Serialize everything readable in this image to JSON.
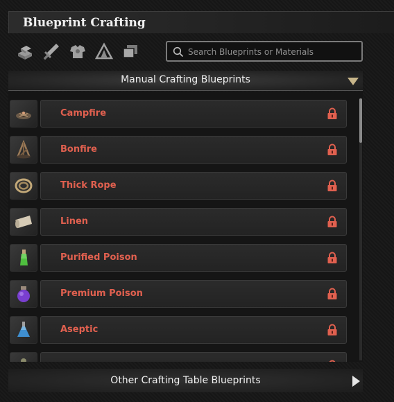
{
  "window": {
    "title": "Blueprint Crafting"
  },
  "categories": [
    {
      "icon": "materials-icon"
    },
    {
      "icon": "weapons-icon"
    },
    {
      "icon": "armor-icon"
    },
    {
      "icon": "tent-icon"
    },
    {
      "icon": "structures-icon"
    }
  ],
  "search": {
    "placeholder": "Search Blueprints or Materials",
    "value": ""
  },
  "manual_section": {
    "label": "Manual Crafting Blueprints"
  },
  "items": [
    {
      "name": "Campfire",
      "icon": "campfire-icon",
      "locked": true
    },
    {
      "name": "Bonfire",
      "icon": "bonfire-icon",
      "locked": true
    },
    {
      "name": "Thick Rope",
      "icon": "rope-icon",
      "locked": true
    },
    {
      "name": "Linen",
      "icon": "linen-icon",
      "locked": true
    },
    {
      "name": "Purified Poison",
      "icon": "purified-poison-icon",
      "locked": true
    },
    {
      "name": "Premium Poison",
      "icon": "premium-poison-icon",
      "locked": true
    },
    {
      "name": "Aseptic",
      "icon": "aseptic-icon",
      "locked": true
    },
    {
      "name": "",
      "icon": "item-icon",
      "locked": true
    }
  ],
  "other_section": {
    "label": "Other Crafting Table Blueprints"
  },
  "colors": {
    "item_name": "#e0604f",
    "lock": "#e0604f",
    "accent": "#c8b68a"
  }
}
